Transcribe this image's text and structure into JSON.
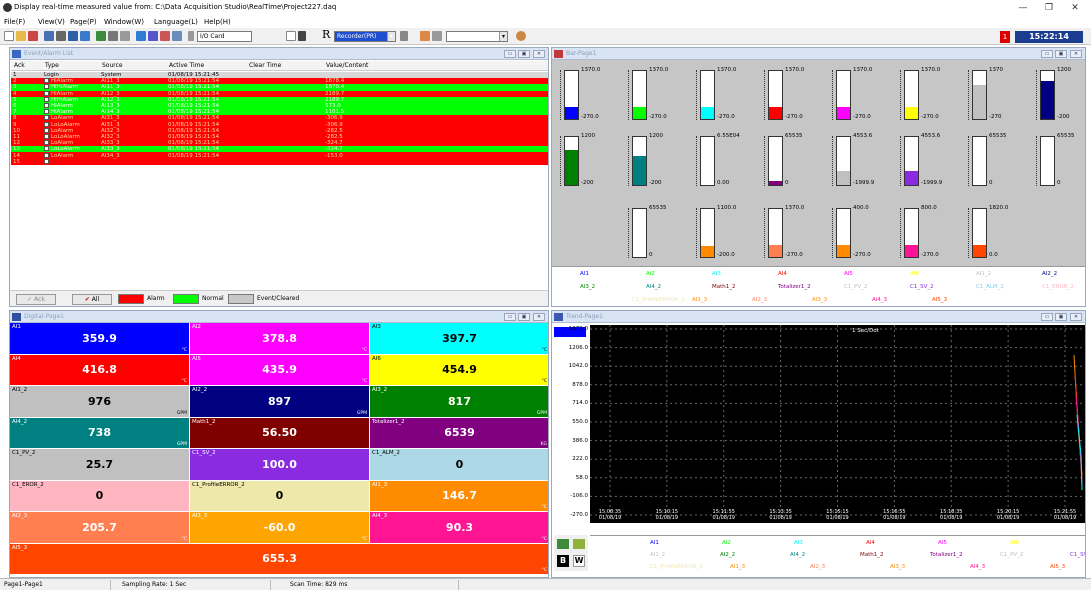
{
  "window": {
    "title": "Display real-time measured value from: C:\\Data Acquisition Studio\\RealTime\\Project227.daq",
    "min": "—",
    "max": "❐",
    "close": "✕"
  },
  "menu": [
    "File(F)",
    "View(V)",
    "Page(P)",
    "Window(W)",
    "Language(L)",
    "Help(H)"
  ],
  "toolbar": {
    "io_card": "I/O Card",
    "recorder": "Recorder(PR)",
    "clock": "15:22:14",
    "alert_count": "1"
  },
  "event_alarm": {
    "title": "Event/Alarm List",
    "headers": [
      "Ack",
      "Type",
      "Source",
      "Active Time",
      "Clear Time",
      "Value/Content"
    ],
    "rows": [
      {
        "ack": "1",
        "type": "Login",
        "source": "System",
        "time": "01/08/19 15:21:45",
        "clear": "",
        "value": "",
        "color": "gray"
      },
      {
        "ack": "2",
        "type": "HiAlarm",
        "source": "AI11_3",
        "time": "01/08/19 15:21:54",
        "clear": "",
        "value": "1878.4",
        "color": "red"
      },
      {
        "ack": "3",
        "type": "HiHiAlarm",
        "source": "AI11_3",
        "time": "01/08/19 15:21:54",
        "clear": "",
        "value": "1870.4",
        "color": "green"
      },
      {
        "ack": "4",
        "type": "HiAlarm",
        "source": "AI12_3",
        "time": "01/08/19 15:21:54",
        "clear": "",
        "value": "2189.7",
        "color": "red"
      },
      {
        "ack": "5",
        "type": "HiHiAlarm",
        "source": "AI12_3",
        "time": "01/08/19 15:21:54",
        "clear": "",
        "value": "2189.7",
        "color": "green"
      },
      {
        "ack": "6",
        "type": "HiAlarm",
        "source": "AI13_3",
        "time": "01/08/19 15:21:54",
        "clear": "",
        "value": "573.0",
        "color": "green"
      },
      {
        "ack": "7",
        "type": "HiAlarm",
        "source": "AI14_3",
        "time": "01/08/19 15:21:54",
        "clear": "",
        "value": "1101.5",
        "color": "green"
      },
      {
        "ack": "8",
        "type": "LoAlarm",
        "source": "AI31_3",
        "time": "01/08/19 15:21:54",
        "clear": "",
        "value": "-306.9",
        "color": "red"
      },
      {
        "ack": "9",
        "type": "LoLoAlarm",
        "source": "AI31_3",
        "time": "01/08/19 15:21:54",
        "clear": "",
        "value": "-306.9",
        "color": "red"
      },
      {
        "ack": "10",
        "type": "LoAlarm",
        "source": "AI32_3",
        "time": "01/08/19 15:21:54",
        "clear": "",
        "value": "-282.5",
        "color": "red"
      },
      {
        "ack": "11",
        "type": "LoLoAlarm",
        "source": "AI32_3",
        "time": "01/08/19 15:21:54",
        "clear": "",
        "value": "-282.5",
        "color": "red"
      },
      {
        "ack": "12",
        "type": "LoAlarm",
        "source": "AI33_3",
        "time": "01/08/19 15:21:54",
        "clear": "",
        "value": "-324.7",
        "color": "red"
      },
      {
        "ack": "13",
        "type": "LoLoAlarm",
        "source": "AI33_3",
        "time": "01/08/19 15:21:54",
        "clear": "",
        "value": "-324.7",
        "color": "green"
      },
      {
        "ack": "14",
        "type": "LoAlarm",
        "source": "AI34_3",
        "time": "01/08/19 15:21:54",
        "clear": "",
        "value": "-153.0",
        "color": "red"
      },
      {
        "ack": "15",
        "type": "",
        "source": "",
        "time": "",
        "clear": "",
        "value": "",
        "color": "red"
      }
    ],
    "footer": {
      "ack": "Ack",
      "all": "All",
      "alarm": "Alarm",
      "normal": "Normal",
      "event": "Event/Cleared"
    }
  },
  "bar_page": {
    "title": "Bar-Page1",
    "bars": [
      {
        "top": "1370.0",
        "bottom": "-270.0",
        "color": "#0000ff",
        "fill": 0.25
      },
      {
        "top": "1370.0",
        "bottom": "-270.0",
        "color": "#00ff00",
        "fill": 0.25
      },
      {
        "top": "1370.0",
        "bottom": "-270.0",
        "color": "#00ffff",
        "fill": 0.25
      },
      {
        "top": "1370.0",
        "bottom": "-270.0",
        "color": "#ff0000",
        "fill": 0.26
      },
      {
        "top": "1370.0",
        "bottom": "-270.0",
        "color": "#ff00ff",
        "fill": 0.26
      },
      {
        "top": "1370.0",
        "bottom": "-270.0",
        "color": "#ffff00",
        "fill": 0.26
      },
      {
        "top": "1370",
        "bottom": "-270",
        "color": "#c0c0c0",
        "fill": 0.7
      },
      {
        "top": "1200",
        "bottom": "-200",
        "color": "#000080",
        "fill": 0.8
      },
      {
        "top": "1200",
        "bottom": "-200",
        "color": "#008000",
        "fill": 0.72
      },
      {
        "top": "1200",
        "bottom": "-200",
        "color": "#008080",
        "fill": 0.6
      },
      {
        "top": "6.55E04",
        "bottom": "0.00",
        "color": "#ffffff",
        "fill": 0.0
      },
      {
        "top": "65535",
        "bottom": "0",
        "color": "#800080",
        "fill": 0.08
      },
      {
        "top": "4553.6",
        "bottom": "-1999.9",
        "color": "#c0c0c0",
        "fill": 0.3
      },
      {
        "top": "4553.6",
        "bottom": "-1999.9",
        "color": "#8a2be2",
        "fill": 0.3
      },
      {
        "top": "65535",
        "bottom": "0",
        "color": "#ffffff",
        "fill": 0.0
      },
      {
        "top": "65535",
        "bottom": "0",
        "color": "#ffffff",
        "fill": 0.0
      },
      {
        "top": "65535",
        "bottom": "0",
        "color": "#ffffff",
        "fill": 0.0
      },
      {
        "top": "1100.0",
        "bottom": "-200.0",
        "color": "#ff8c00",
        "fill": 0.22
      },
      {
        "top": "1370.0",
        "bottom": "-270.0",
        "color": "#ff7f50",
        "fill": 0.25
      },
      {
        "top": "400.0",
        "bottom": "-270.0",
        "color": "#ff8c00",
        "fill": 0.25
      },
      {
        "top": "800.0",
        "bottom": "-270.0",
        "color": "#ff1493",
        "fill": 0.25
      },
      {
        "top": "1820.0",
        "bottom": "0.0",
        "color": "#ff4500",
        "fill": 0.25
      }
    ],
    "legend": [
      {
        "t": "AI1",
        "c": "#0000ff"
      },
      {
        "t": "AI2",
        "c": "#00ff00"
      },
      {
        "t": "AI3",
        "c": "#00ffff"
      },
      {
        "t": "AI4",
        "c": "#ff0000"
      },
      {
        "t": "AI5",
        "c": "#ff00ff"
      },
      {
        "t": "AI6",
        "c": "#ffff00"
      },
      {
        "t": "AI1_2",
        "c": "#c0c0c0"
      },
      {
        "t": "AI2_2",
        "c": "#000080"
      },
      {
        "t": "AI3_2",
        "c": "#008000"
      },
      {
        "t": "AI4_2",
        "c": "#008080"
      },
      {
        "t": "Math1_2",
        "c": "#800000"
      },
      {
        "t": "Totalizer1_2",
        "c": "#800080"
      },
      {
        "t": "C1_PV_2",
        "c": "#c0c0c0"
      },
      {
        "t": "C1_SV_2",
        "c": "#8a2be2"
      },
      {
        "t": "C1_ALM_2",
        "c": "#87ceeb"
      },
      {
        "t": "C1_EROR_2",
        "c": "#ffb6c1"
      },
      {
        "t": "C1_ProfileERROR_2",
        "c": "#eee8aa"
      },
      {
        "t": "AI1_3",
        "c": "#ff8c00"
      },
      {
        "t": "AI2_3",
        "c": "#ff7f50"
      },
      {
        "t": "AI3_3",
        "c": "#ff8c00"
      },
      {
        "t": "AI4_3",
        "c": "#ff1493"
      },
      {
        "t": "AI5_3",
        "c": "#ff4500"
      }
    ]
  },
  "digital": {
    "title": "Digital-Page1",
    "cells": [
      {
        "n": "AI1",
        "v": "359.9",
        "u": "°C",
        "bg": "#0000ff",
        "fg": "#fff"
      },
      {
        "n": "AI2",
        "v": "378.8",
        "u": "°C",
        "bg": "#ff00ff",
        "fg": "#fff"
      },
      {
        "n": "AI3",
        "v": "397.7",
        "u": "°C",
        "bg": "#00ffff",
        "fg": "#000"
      },
      {
        "n": "AI4",
        "v": "416.8",
        "u": "°C",
        "bg": "#ff0000",
        "fg": "#fff"
      },
      {
        "n": "AI5",
        "v": "435.9",
        "u": "°C",
        "bg": "#ff00ff",
        "fg": "#fff"
      },
      {
        "n": "AI6",
        "v": "454.9",
        "u": "°C",
        "bg": "#ffff00",
        "fg": "#000"
      },
      {
        "n": "AI1_2",
        "v": "976",
        "u": "GPM",
        "bg": "#c0c0c0",
        "fg": "#000"
      },
      {
        "n": "AI2_2",
        "v": "897",
        "u": "GPM",
        "bg": "#000080",
        "fg": "#fff"
      },
      {
        "n": "AI3_2",
        "v": "817",
        "u": "GPM",
        "bg": "#008000",
        "fg": "#fff"
      },
      {
        "n": "AI4_2",
        "v": "738",
        "u": "GPM",
        "bg": "#008080",
        "fg": "#fff"
      },
      {
        "n": "Math1_2",
        "v": "56.50",
        "u": "",
        "bg": "#800000",
        "fg": "#fff"
      },
      {
        "n": "Totalizer1_2",
        "v": "6539",
        "u": "KG",
        "bg": "#800080",
        "fg": "#fff"
      },
      {
        "n": "C1_PV_2",
        "v": "25.7",
        "u": "",
        "bg": "#c0c0c0",
        "fg": "#000"
      },
      {
        "n": "C1_SV_2",
        "v": "100.0",
        "u": "",
        "bg": "#8a2be2",
        "fg": "#fff"
      },
      {
        "n": "C1_ALM_2",
        "v": "0",
        "u": "",
        "bg": "#add8e6",
        "fg": "#000"
      },
      {
        "n": "C1_EROR_2",
        "v": "0",
        "u": "",
        "bg": "#ffb6c1",
        "fg": "#000"
      },
      {
        "n": "C1_ProfileERROR_2",
        "v": "0",
        "u": "",
        "bg": "#eee8aa",
        "fg": "#000"
      },
      {
        "n": "AI1_3",
        "v": "146.7",
        "u": "°C",
        "bg": "#ff8c00",
        "fg": "#fff"
      },
      {
        "n": "AI2_3",
        "v": "205.7",
        "u": "°C",
        "bg": "#ff7f50",
        "fg": "#fff"
      },
      {
        "n": "AI3_3",
        "v": "-60.0",
        "u": "°C",
        "bg": "#ffa500",
        "fg": "#fff"
      },
      {
        "n": "AI4_3",
        "v": "90.3",
        "u": "°C",
        "bg": "#ff1493",
        "fg": "#fff"
      },
      {
        "n": "AI5_3",
        "v": "655.3",
        "u": "°C",
        "bg": "#ff4500",
        "fg": "#fff"
      }
    ]
  },
  "trend": {
    "title": "Trend-Page1",
    "rate": "1 Sec/Dot",
    "yticks": [
      "1370.0",
      "1206.0",
      "1042.0",
      "878.0",
      "714.0",
      "550.0",
      "386.0",
      "222.0",
      "58.0",
      "-106.0",
      "-270.0"
    ],
    "xticks": [
      {
        "t": "15:08:35",
        "d": "01/08/19"
      },
      {
        "t": "15:10:15",
        "d": "01/08/19"
      },
      {
        "t": "15:11:55",
        "d": "01/08/19"
      },
      {
        "t": "15:13:35",
        "d": "01/08/19"
      },
      {
        "t": "15:15:15",
        "d": "01/08/19"
      },
      {
        "t": "15:16:55",
        "d": "01/08/19"
      },
      {
        "t": "15:18:35",
        "d": "01/08/19"
      },
      {
        "t": "15:20:15",
        "d": "01/08/19"
      },
      {
        "t": "15:21:55",
        "d": "01/08/19"
      }
    ],
    "legend": [
      {
        "t": "AI1",
        "c": "#0000ff"
      },
      {
        "t": "AI2",
        "c": "#00ff00"
      },
      {
        "t": "AI3",
        "c": "#00ffff"
      },
      {
        "t": "AI4",
        "c": "#ff0000"
      },
      {
        "t": "AI5",
        "c": "#ff00ff"
      },
      {
        "t": "AI6",
        "c": "#ffff00"
      },
      {
        "t": "AI1_2",
        "c": "#c0c0c0"
      },
      {
        "t": "AI2_2",
        "c": "#008000"
      },
      {
        "t": "AI4_2",
        "c": "#008080"
      },
      {
        "t": "Math1_2",
        "c": "#800000"
      },
      {
        "t": "Totalizer1_2",
        "c": "#800080"
      },
      {
        "t": "C1_PV_2",
        "c": "#c0c0c0"
      },
      {
        "t": "C1_SV_2",
        "c": "#8a2be2"
      },
      {
        "t": "C1_ProfileERROR_2",
        "c": "#eee8aa"
      },
      {
        "t": "AI1_3",
        "c": "#ff8c00"
      },
      {
        "t": "AI2_3",
        "c": "#ff7f50"
      },
      {
        "t": "AI3_3",
        "c": "#ff8c00"
      },
      {
        "t": "AI4_3",
        "c": "#ff1493"
      },
      {
        "t": "AI5_3",
        "c": "#ff4500"
      }
    ],
    "btn_b": "B",
    "btn_w": "W"
  },
  "status": {
    "page": "Page1-Page1",
    "rate": "Sampling Rate: 1 Sec",
    "scan": "Scan Time: 829 ms"
  }
}
